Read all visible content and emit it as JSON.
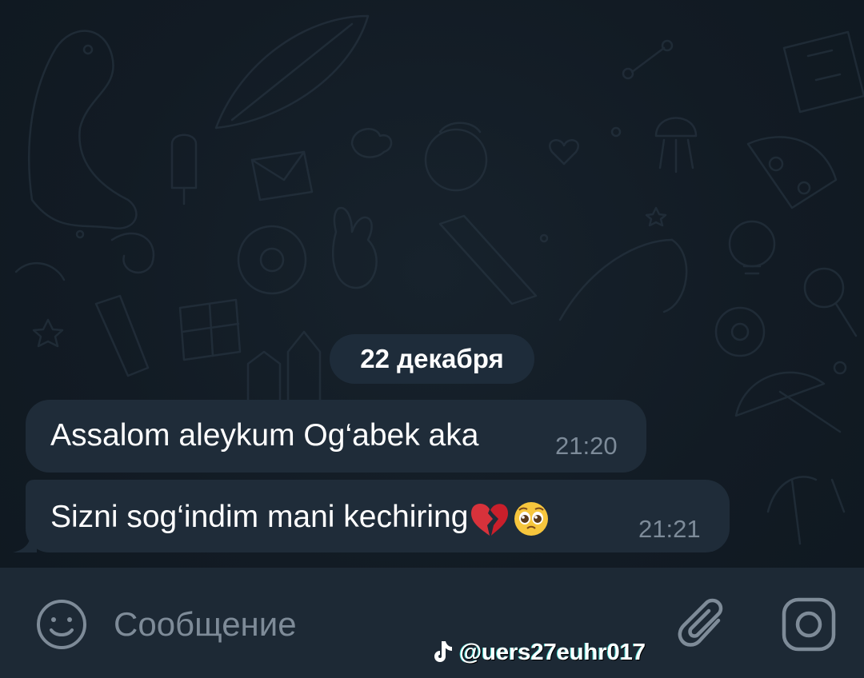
{
  "chat": {
    "date_separator": "22 декабря",
    "messages": [
      {
        "text": "Assalom aleykum Og‘abek aka",
        "time": "21:20"
      },
      {
        "text": "Sizni sog‘indim mani kechiring",
        "emojis": [
          "broken-heart",
          "pleading-face"
        ],
        "time": "21:21"
      }
    ]
  },
  "composer": {
    "placeholder": "Сообщение",
    "value": "",
    "icons": {
      "left": "smile-icon",
      "attach": "paperclip-icon",
      "camera": "camera-icon"
    }
  },
  "watermark": {
    "text": "@uers27euhr017",
    "icon": "tiktok-logo-icon"
  },
  "colors": {
    "background": "#121b24",
    "bubble": "#1f2c39",
    "date_chip": "#1e2c3a",
    "time_text": "#7d8b99",
    "input_bar": "#1d2935",
    "icon": "#7e8b98"
  }
}
